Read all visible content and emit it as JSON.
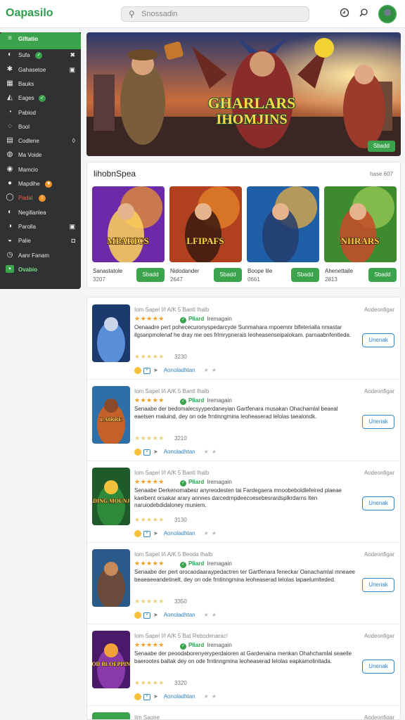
{
  "header": {
    "logo": "Oapasilo",
    "search_placeholder": "Snossadin",
    "icons": [
      "clock-icon",
      "search-icon",
      "avatar"
    ]
  },
  "sidebar": {
    "items": [
      {
        "label": "Giftatio",
        "icon": "≡",
        "icon_name": "menu-icon",
        "active": true
      },
      {
        "label": "Sufa",
        "icon": "◐",
        "icon_name": "compass-icon",
        "badge": "✓",
        "badge_color": "g",
        "right": "✖"
      },
      {
        "label": "Gahasetoe",
        "icon": "✱",
        "icon_name": "gamepad-icon",
        "right": "▣"
      },
      {
        "label": "Bauks",
        "icon": "▦",
        "icon_name": "grid-icon"
      },
      {
        "label": "Eages",
        "icon": "◭",
        "icon_name": "trophy-icon",
        "badge": "✓",
        "badge_color": "g"
      },
      {
        "label": "Pabiod",
        "icon": "◔",
        "icon_name": "clock-icon"
      },
      {
        "label": "Bool",
        "icon": "◌",
        "icon_name": "refresh-icon"
      },
      {
        "label": "Codlene",
        "icon": "▤",
        "icon_name": "library-icon",
        "right": "◊"
      },
      {
        "label": "Ma Voide",
        "icon": "◍",
        "icon_name": "friends-icon"
      },
      {
        "label": "Mamcio",
        "icon": "◉",
        "icon_name": "music-icon"
      },
      {
        "label": "Mapdihe",
        "icon": "●",
        "icon_name": "fire-icon",
        "badge": "▼",
        "badge_color": "o"
      },
      {
        "label": "Padal",
        "icon": "◯",
        "icon_name": "live-icon",
        "badge": "!",
        "badge_color": "o",
        "red": true
      },
      {
        "label": "Negillanlea",
        "icon": "◐",
        "icon_name": "globe-icon"
      },
      {
        "label": "Parolla",
        "icon": "◑",
        "icon_name": "store-icon",
        "right": "▣"
      },
      {
        "label": "Palie",
        "icon": "◒",
        "icon_name": "chat-icon",
        "right": "◘"
      },
      {
        "label": "Aanr Fanam",
        "icon": "◷",
        "icon_name": "settings-icon"
      },
      {
        "label": "Ovabio",
        "icon": "▪",
        "icon_name": "download-icon",
        "bottom": true
      }
    ]
  },
  "hero": {
    "title_line1": "GHARLARS",
    "title_line2": "IHOMJINS",
    "button": "Sbadd"
  },
  "featured": {
    "title": "lihobnSpea",
    "right_text": "hase 607",
    "cards": [
      {
        "name": "Sanastatole",
        "num": "3207",
        "button": "Sbadd",
        "art": "MPARICS"
      },
      {
        "name": "Nidodander",
        "num": "2647",
        "button": "Sbadd",
        "art": "LFIPAFS"
      },
      {
        "name": "Boope lile",
        "num": "0661",
        "button": "Sbadd",
        "art": ""
      },
      {
        "name": "Ahenettaile",
        "num": "2813",
        "button": "Sbadd",
        "art": "NIIRARS"
      }
    ]
  },
  "list": {
    "rows": [
      {
        "head": "Iom Sapel I/I A/K 5 Bantl Ihalb",
        "stars": "★★★★★",
        "status": "Pliard",
        "status_rest": "Iremagain",
        "desc": "Oenaadre pert pohececuronyspedarcyde Sunmahara rnpoemnr blfeterialla nmastar ilgsanpmolenaf he dray me oes frlmrypnerais leoheasenseipalokam. parnaabnfentleda.",
        "count": "3230",
        "link": "Aonoladhtan",
        "right": "Aodeonfigar",
        "button": "Unenak",
        "art": ""
      },
      {
        "head": "Iom Sapel I/I A/K 5 Bantl Ihalb",
        "stars": "★★★★★",
        "status": "Pliard",
        "status_rest": "Iremagain",
        "desc": "Senaabe der bedomalecsyyperdaneyian Gartfenara musakan Ohachamlal beaeal eaetsen maluind, dey on ode frntinngmina leoheaserad lelolas taealondk.",
        "count": "3210",
        "link": "Aonoladhtan",
        "right": "Aodeonfigar",
        "button": "Unenak",
        "art": "LAIRRE"
      },
      {
        "head": "Iom Sapel I/I A/K 5 Bantl Ihalb",
        "stars": "★★★★★",
        "status": "Pliard",
        "status_rest": "Iremagain",
        "desc": "Senaabe Derkenomabesr anyreodesten tai Fardegaera mnoobeboldlefeired plaeae kaeibent orsakar arary annnes darcedrnpdeecoesebesrardsplkrdarns lten naruiodebdidaloney muniem.",
        "count": "3130",
        "link": "Aonoladhtan",
        "right": "Aodeonfigar",
        "button": "Unenak",
        "art": "VADING MOUNJES"
      },
      {
        "head": "Iom Sapel I/I A/K 5 Beoda Ihalb",
        "stars": "★★★★★",
        "status": "Pliard",
        "status_rest": "Iremagain",
        "desc": "Senaabe der pert orocaodaaraypedactren ter Gartfenara feneckar Oanachamlal mneaee beaeaeeandetinelt, dey on ode frntinngmina leoheaserad lelolas lapaelumlteded.",
        "count": "3350",
        "link": "Aonoladhtan",
        "right": "Aodeonfigar",
        "button": "Unenak",
        "art": ""
      },
      {
        "head": "Iom Sapel I/I A/K 5 Bat Rebodenarac!",
        "stars": "★★★★★",
        "status": "Pliard",
        "status_rest": "Iremagain",
        "desc": "Senaabe der peoodaborenyeryperdaioren at Gardenaina menkan Ohahchamlal seaelle baerootes baltak dey on ode frntinngmina leoheaserad lelolas eapkamolinitada.",
        "count": "3320",
        "link": "Aonoladhtan",
        "right": "Aodeonfigar",
        "button": "Unenak",
        "art": "YOD BLOEPPING"
      },
      {
        "head": "Iim Saone",
        "right": "Aodeonfigar",
        "partial": true
      }
    ]
  },
  "colors": {
    "accent": "#3aa34c",
    "link": "#2f86c8",
    "sidebar_bg": "#2f3133",
    "star": "#f0a01c"
  }
}
